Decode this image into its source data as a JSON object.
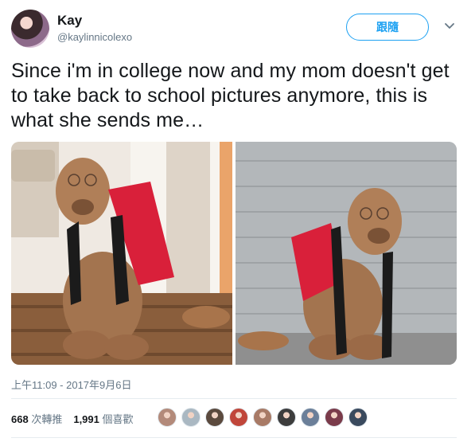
{
  "user": {
    "display_name": "Kay",
    "handle": "@kaylinnicolexo"
  },
  "follow_button": {
    "label": "跟隨"
  },
  "tweet": {
    "text": "Since i'm in college now and my mom doesn't get to take back to school pictures anymore, this is what she sends me…",
    "timestamp": "上午11:09 - 2017年9月6日"
  },
  "stats": {
    "retweets_count": "668",
    "retweets_label": "次轉推",
    "likes_count": "1,991",
    "likes_label": "個喜歡"
  },
  "liker_colors": [
    "#b38a7a",
    "#aab8c2",
    "#5b4a3e",
    "#c0463a",
    "#a87a66",
    "#3d3d3d",
    "#6b7f99",
    "#7a3b4a",
    "#3a4a5e"
  ],
  "colors": {
    "accent": "#1da1f2",
    "secondary_text": "#657786",
    "primary_text": "#14171a"
  }
}
